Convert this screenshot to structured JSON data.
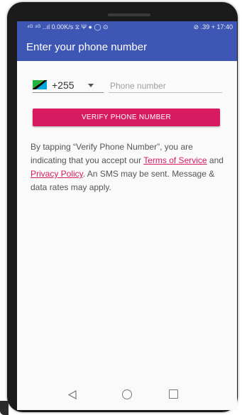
{
  "statusbar": {
    "left": "⁴ᴳ ⁴ᴳ ‥ıl 0.00K/s ⧖ Ψ ● ◯ ⊙",
    "right": "⊘ .39 + 17:40"
  },
  "appbar": {
    "title": "Enter your phone number"
  },
  "phone": {
    "country_code": "+255",
    "placeholder": "Phone number"
  },
  "verify_button": {
    "label": "VERIFY PHONE NUMBER"
  },
  "terms": {
    "part1": "By tapping “Verify Phone Number”, you are indicating that you accept our ",
    "terms_link": "Terms of Service",
    "part2": " and ",
    "privacy_link": "Privacy Policy",
    "part3": ". An SMS may be sent. Message & data rates may apply."
  },
  "colors": {
    "primary": "#3f57b4",
    "accent": "#d81b60"
  },
  "icons": {
    "flag": "tanzania-flag-icon",
    "dropdown": "chevron-down-icon",
    "back": "back-icon",
    "home": "home-icon",
    "recents": "recents-icon"
  }
}
